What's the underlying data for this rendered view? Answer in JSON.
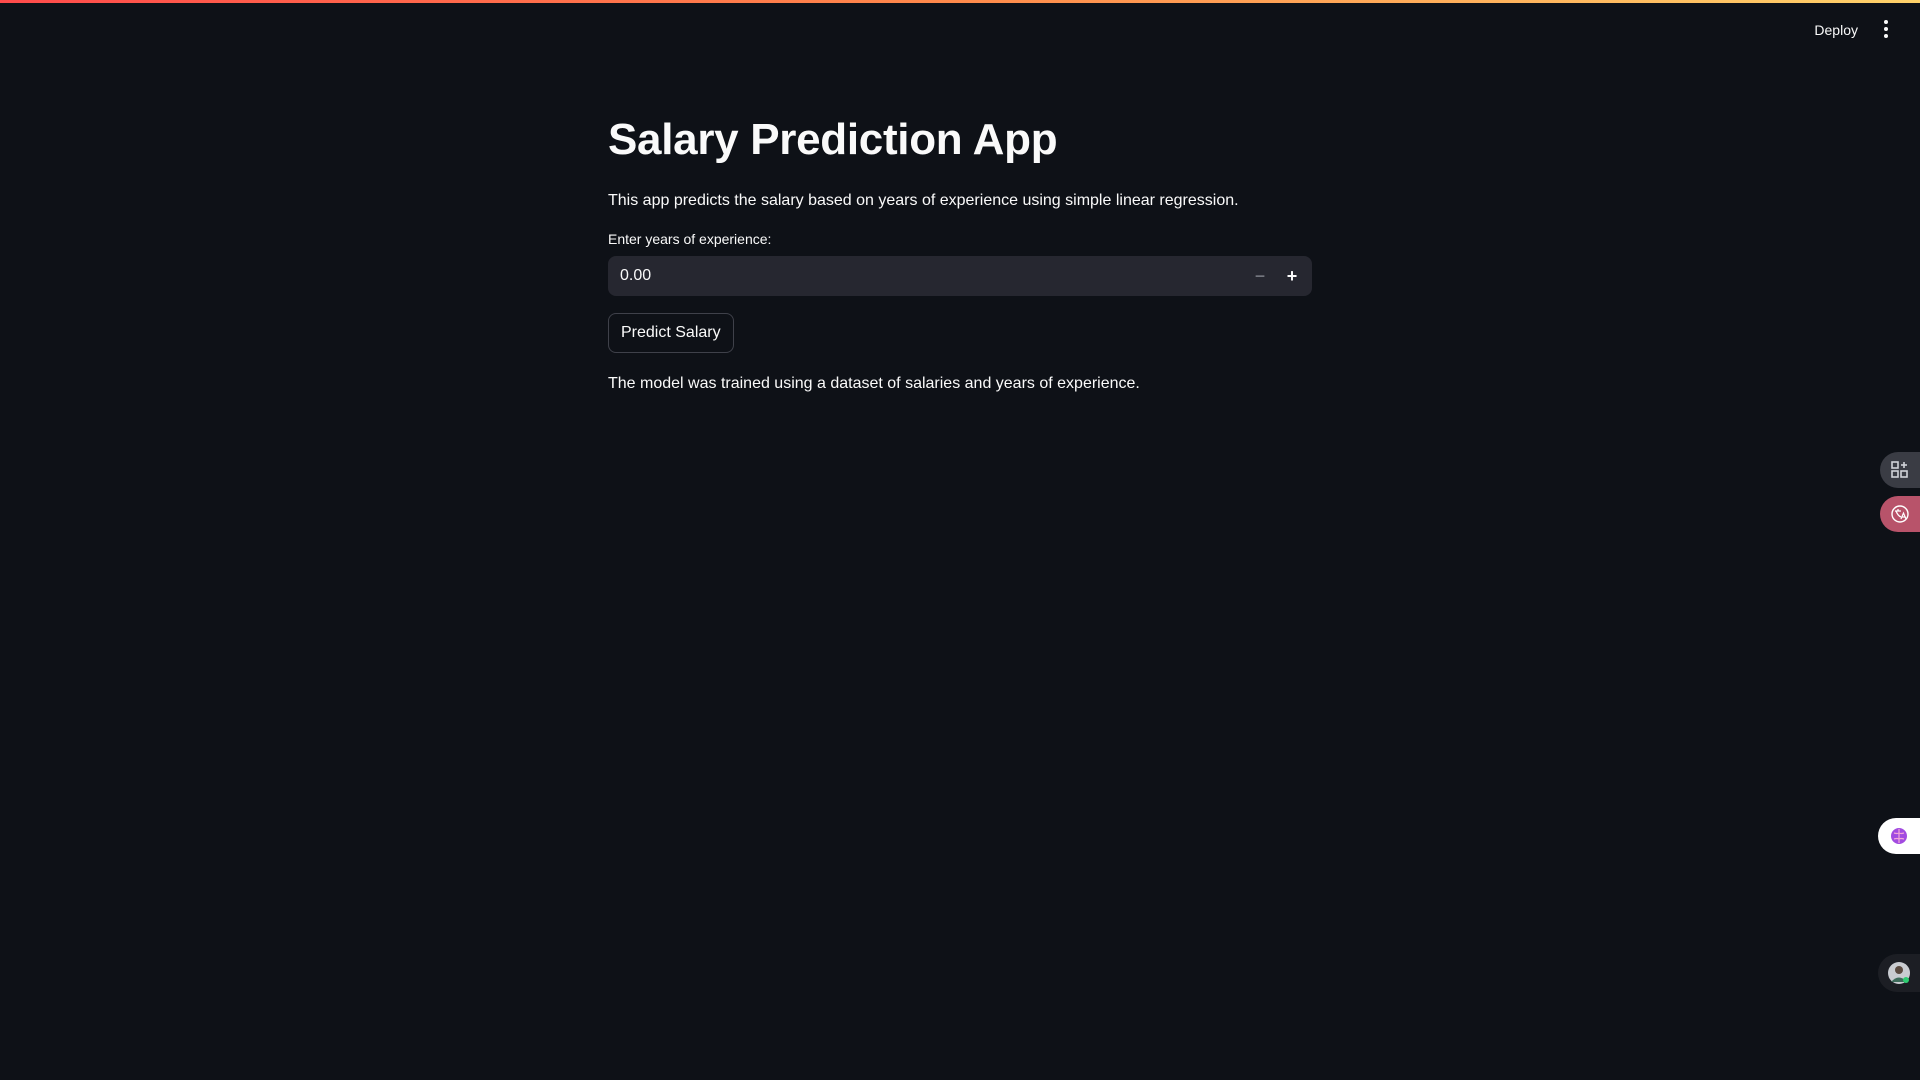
{
  "header": {
    "deploy_label": "Deploy"
  },
  "main": {
    "title": "Salary Prediction App",
    "description": "This app predicts the salary based on years of experience using simple linear regression.",
    "experience_input": {
      "label": "Enter years of experience:",
      "value": "0.00",
      "decrement_symbol": "−",
      "increment_symbol": "+"
    },
    "predict_button_label": "Predict Salary",
    "note": "The model was trained using a dataset of salaries and years of experience."
  },
  "side_widgets": [
    {
      "icon": "apps-grid-icon"
    },
    {
      "icon": "translate-icon"
    },
    {
      "icon": "brain-icon"
    },
    {
      "icon": "avatar-icon"
    }
  ],
  "colors": {
    "background": "#0e1117",
    "input_background": "#262730",
    "text": "#fafafa",
    "accent_gradient_start": "#ff4b4b",
    "accent_gradient_end": "#ffd26a"
  }
}
